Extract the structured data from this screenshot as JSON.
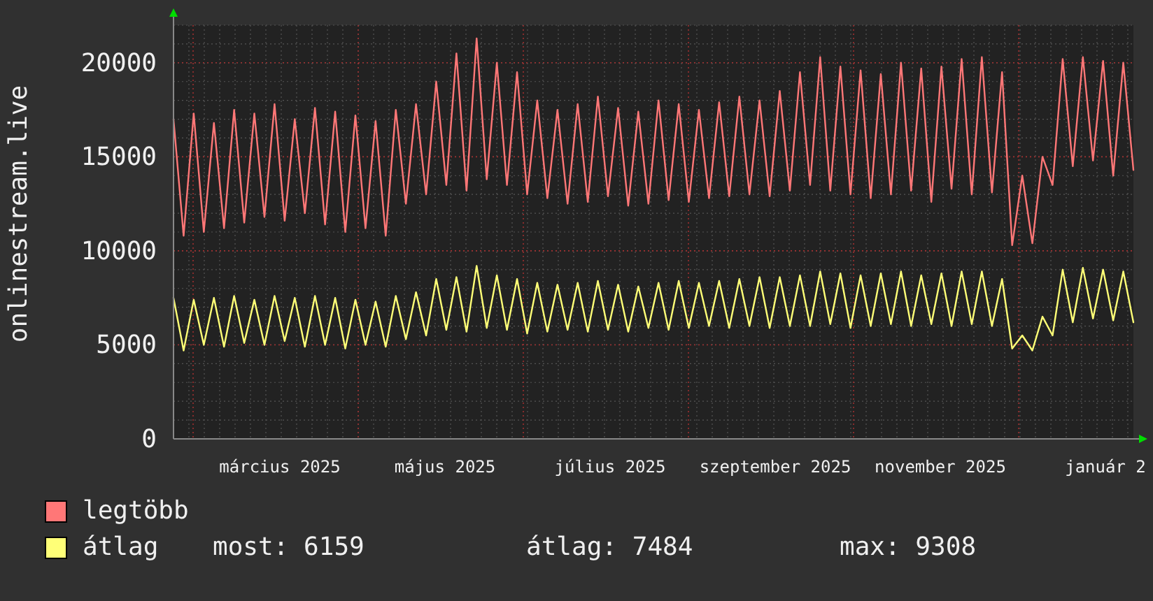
{
  "chart": {
    "x_labels": [
      "március 2025",
      "május 2025",
      "július 2025",
      "szeptember 2025",
      "november 2025",
      "január 2"
    ],
    "chart_data": {
      "type": "line",
      "ylabel": "onlinestream.live",
      "grid": true,
      "ylim": [
        0,
        22000
      ],
      "yticks": [
        0,
        5000,
        10000,
        15000,
        20000
      ],
      "series": [
        {
          "name": "legtöbb",
          "color": "#ff7777",
          "values": [
            17000,
            10800,
            17300,
            11000,
            16800,
            11200,
            17500,
            11500,
            17300,
            11800,
            17800,
            11600,
            17000,
            12000,
            17600,
            11400,
            17400,
            11000,
            17200,
            11200,
            16900,
            10800,
            17500,
            12500,
            17800,
            13000,
            19000,
            13500,
            20500,
            13200,
            21300,
            13800,
            20000,
            13500,
            19500,
            13000,
            18000,
            12800,
            17500,
            12500,
            17800,
            12600,
            18200,
            12900,
            17600,
            12400,
            17400,
            12500,
            18000,
            12700,
            17800,
            12600,
            17500,
            12800,
            17900,
            12900,
            18200,
            13000,
            18000,
            12900,
            18500,
            13200,
            19500,
            13500,
            20300,
            13200,
            19800,
            13000,
            19600,
            12800,
            19400,
            13000,
            20000,
            13200,
            19700,
            12600,
            19800,
            13300,
            20200,
            13000,
            20300,
            13100,
            19500,
            10300,
            14000,
            10400,
            15000,
            13500,
            20200,
            14500,
            20300,
            14800,
            20100,
            14000,
            20000,
            14300
          ]
        },
        {
          "name": "átlag",
          "color": "#ffff77",
          "values": [
            7500,
            4700,
            7400,
            5000,
            7500,
            4900,
            7600,
            5100,
            7400,
            5000,
            7600,
            5200,
            7500,
            4900,
            7600,
            5000,
            7500,
            4800,
            7400,
            5000,
            7300,
            4900,
            7600,
            5300,
            7800,
            5500,
            8500,
            5800,
            8600,
            5700,
            9200,
            5900,
            8700,
            5800,
            8500,
            5600,
            8300,
            5700,
            8200,
            5800,
            8300,
            5700,
            8400,
            5800,
            8200,
            5700,
            8100,
            5900,
            8300,
            5800,
            8400,
            5900,
            8300,
            6000,
            8400,
            5900,
            8500,
            6000,
            8600,
            5900,
            8600,
            6000,
            8700,
            6000,
            8900,
            6100,
            8800,
            5900,
            8700,
            6000,
            8800,
            6100,
            8900,
            6000,
            8700,
            6100,
            8800,
            6000,
            8900,
            6100,
            8900,
            6000,
            8500,
            4800,
            5500,
            4700,
            6500,
            5500,
            9000,
            6200,
            9100,
            6400,
            9000,
            6300,
            8900,
            6200
          ]
        }
      ]
    }
  },
  "stats": [
    "most: 6159",
    "átlag: 7484",
    "max: 9308"
  ]
}
